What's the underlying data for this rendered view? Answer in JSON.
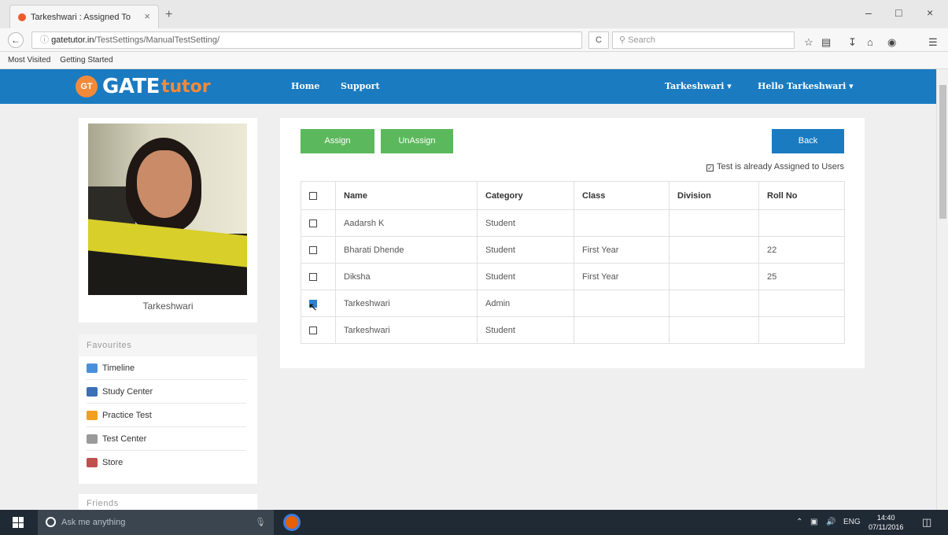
{
  "browser": {
    "tab_title": "Tarkeshwari : Assigned To",
    "tab_close": "×",
    "new_tab": "+",
    "url_host": "gatetutor.in",
    "url_path": "/TestSettings/ManualTestSetting/",
    "reload": "C",
    "search_placeholder": "Search",
    "window_minimize": "–",
    "window_maximize": "□",
    "window_close": "×",
    "bookmarks": [
      "Most Visited",
      "Getting Started"
    ]
  },
  "site": {
    "logo_badge": "GT",
    "logo_gate": "GATE",
    "logo_tutor": "tutor",
    "nav": [
      "Home",
      "Support"
    ],
    "user_menu": "Tarkeshwari ▾",
    "greeting_menu": "Hello Tarkeshwari ▾"
  },
  "sidebar": {
    "profile_name": "Tarkeshwari",
    "favourites_title": "Favourites",
    "favourites": [
      {
        "label": "Timeline",
        "icon": "timeline-icon",
        "color": "#4a90d9"
      },
      {
        "label": "Study Center",
        "icon": "study-center-icon",
        "color": "#3b6fb6"
      },
      {
        "label": "Practice Test",
        "icon": "practice-test-icon",
        "color": "#f0a020"
      },
      {
        "label": "Test Center",
        "icon": "test-center-icon",
        "color": "#9a9a9a"
      },
      {
        "label": "Store",
        "icon": "store-icon",
        "color": "#c0504d"
      }
    ],
    "friends_title": "Friends"
  },
  "main": {
    "assign_label": "Assign",
    "unassign_label": "UnAssign",
    "back_label": "Back",
    "assigned_note": "Test is already Assigned to Users",
    "columns": [
      "Name",
      "Category",
      "Class",
      "Division",
      "Roll No"
    ],
    "rows": [
      {
        "checked": false,
        "name": "Aadarsh K",
        "category": "Student",
        "class": "",
        "division": "",
        "roll": ""
      },
      {
        "checked": false,
        "name": "Bharati Dhende",
        "category": "Student",
        "class": "First Year",
        "division": "",
        "roll": "22"
      },
      {
        "checked": false,
        "name": "Diksha",
        "category": "Student",
        "class": "First Year",
        "division": "",
        "roll": "25"
      },
      {
        "checked": true,
        "name": "Tarkeshwari",
        "category": "Admin",
        "class": "",
        "division": "",
        "roll": ""
      },
      {
        "checked": false,
        "name": "Tarkeshwari",
        "category": "Student",
        "class": "",
        "division": "",
        "roll": ""
      }
    ]
  },
  "taskbar": {
    "search_placeholder": "Ask me anything",
    "language": "ENG",
    "time": "14:40",
    "date": "07/11/2016"
  },
  "colors": {
    "header_blue": "#1a7bc1",
    "button_green": "#5cb85c",
    "logo_orange": "#f28a3a"
  }
}
